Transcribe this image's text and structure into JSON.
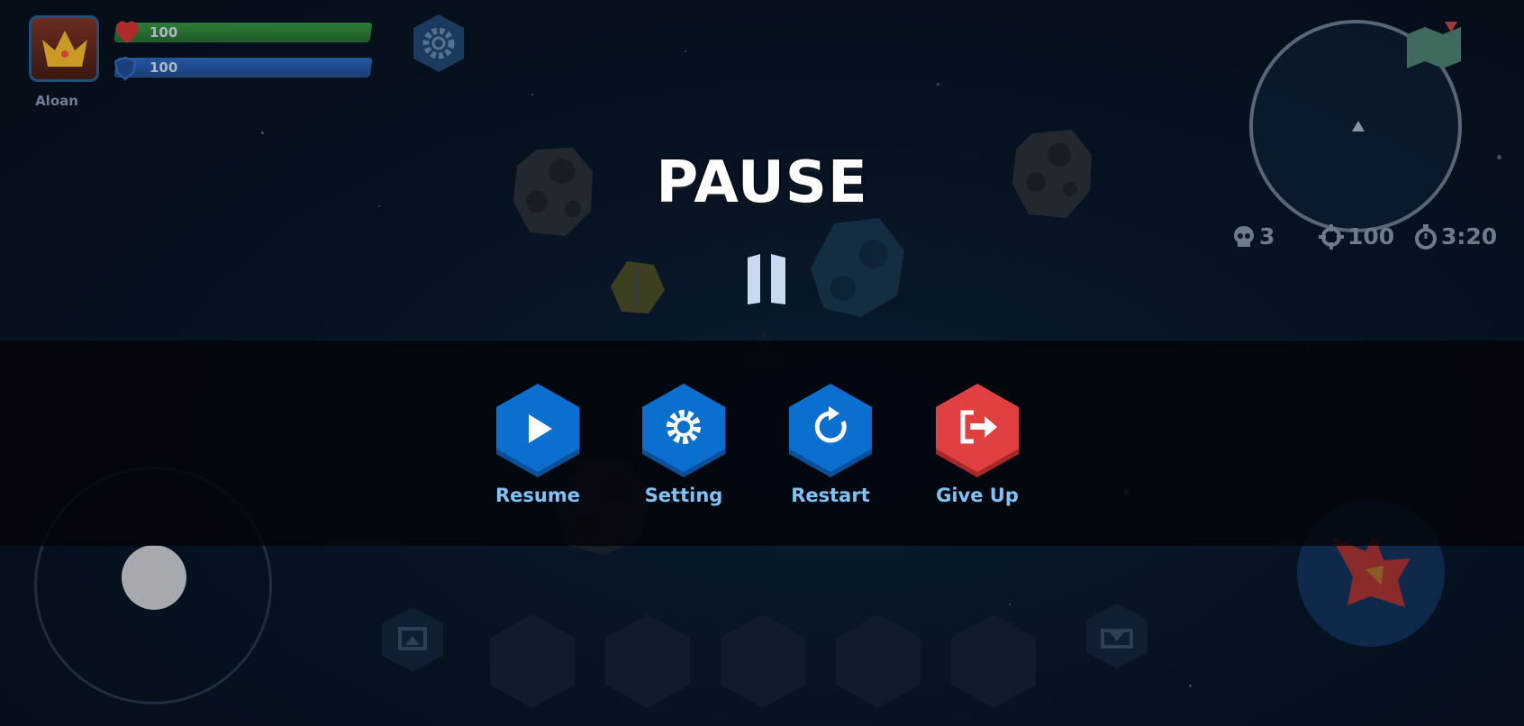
{
  "hud": {
    "player_name": "Aloan",
    "health": {
      "value": "100",
      "fraction": 1.0
    },
    "shield": {
      "value": "100",
      "fraction": 1.0
    },
    "kills": "3",
    "score": "100",
    "timer": "3:20"
  },
  "pause": {
    "title": "PAUSE",
    "buttons": [
      {
        "label": "Resume",
        "icon": "play-icon",
        "color": "#0b6fd0"
      },
      {
        "label": "Setting",
        "icon": "gear-icon",
        "color": "#0b6fd0"
      },
      {
        "label": "Restart",
        "icon": "restart-icon",
        "color": "#0b6fd0"
      },
      {
        "label": "Give Up",
        "icon": "exit-icon",
        "color": "#e0403f"
      }
    ]
  },
  "colors": {
    "health_bar": "#2d7a37",
    "shield_bar": "#2356a1",
    "button_blue": "#0b6fd0",
    "button_red": "#e0403f",
    "label_text": "#7fc2f5"
  }
}
